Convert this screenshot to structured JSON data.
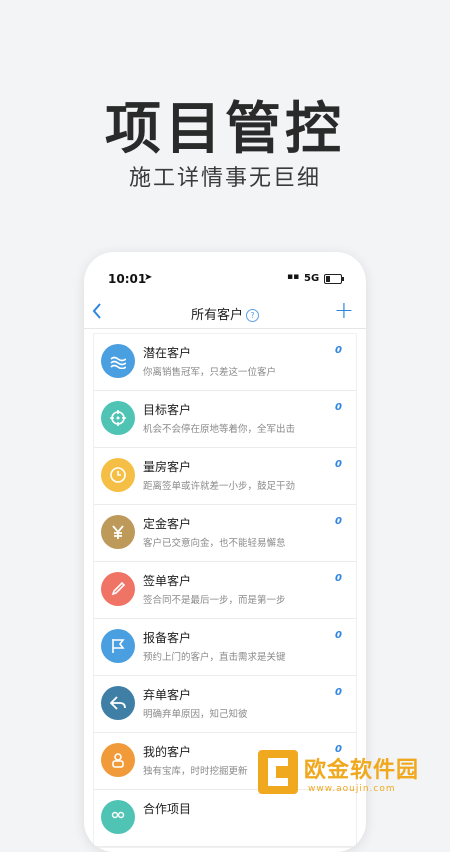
{
  "headline": "项目管控",
  "subhead": "施工详情事无巨细",
  "status": {
    "time": "10:01",
    "network": "5G"
  },
  "nav": {
    "title": "所有客户",
    "help": "?",
    "back": "<",
    "add": "+"
  },
  "items": [
    {
      "name": "潜在客户",
      "desc": "你离销售冠军，只差这一位客户",
      "count": "0",
      "color": "#4a9fe0",
      "icon": "waves-icon"
    },
    {
      "name": "目标客户",
      "desc": "机会不会停在原地等着你，全军出击",
      "count": "0",
      "color": "#4fc4b5",
      "icon": "target-icon"
    },
    {
      "name": "量房客户",
      "desc": "距离签单或许就差一小步，鼓足干劲",
      "count": "0",
      "color": "#f5bf45",
      "icon": "clock-icon"
    },
    {
      "name": "定金客户",
      "desc": "客户已交意向金，也不能轻易懈怠",
      "count": "0",
      "color": "#bd9a5a",
      "icon": "yen-icon"
    },
    {
      "name": "签单客户",
      "desc": "签合同不是最后一步，而是第一步",
      "count": "0",
      "color": "#ef7466",
      "icon": "pencil-icon"
    },
    {
      "name": "报备客户",
      "desc": "预约上门的客户，直击需求是关键",
      "count": "0",
      "color": "#4a9fe0",
      "icon": "flag-icon"
    },
    {
      "name": "弃单客户",
      "desc": "明确弃单原因，知己知彼",
      "count": "0",
      "color": "#3f7fa6",
      "icon": "back-arrow-icon"
    },
    {
      "name": "我的客户",
      "desc": "独有宝库，时时挖掘更新",
      "count": "0",
      "color": "#f19a3a",
      "icon": "person-icon"
    },
    {
      "name": "合作项目",
      "desc": "",
      "count": "",
      "color": "#4fc4b5",
      "icon": "partner-icon"
    }
  ],
  "watermark": {
    "text": "欧金软件园",
    "url": "www.aoujin.com"
  }
}
